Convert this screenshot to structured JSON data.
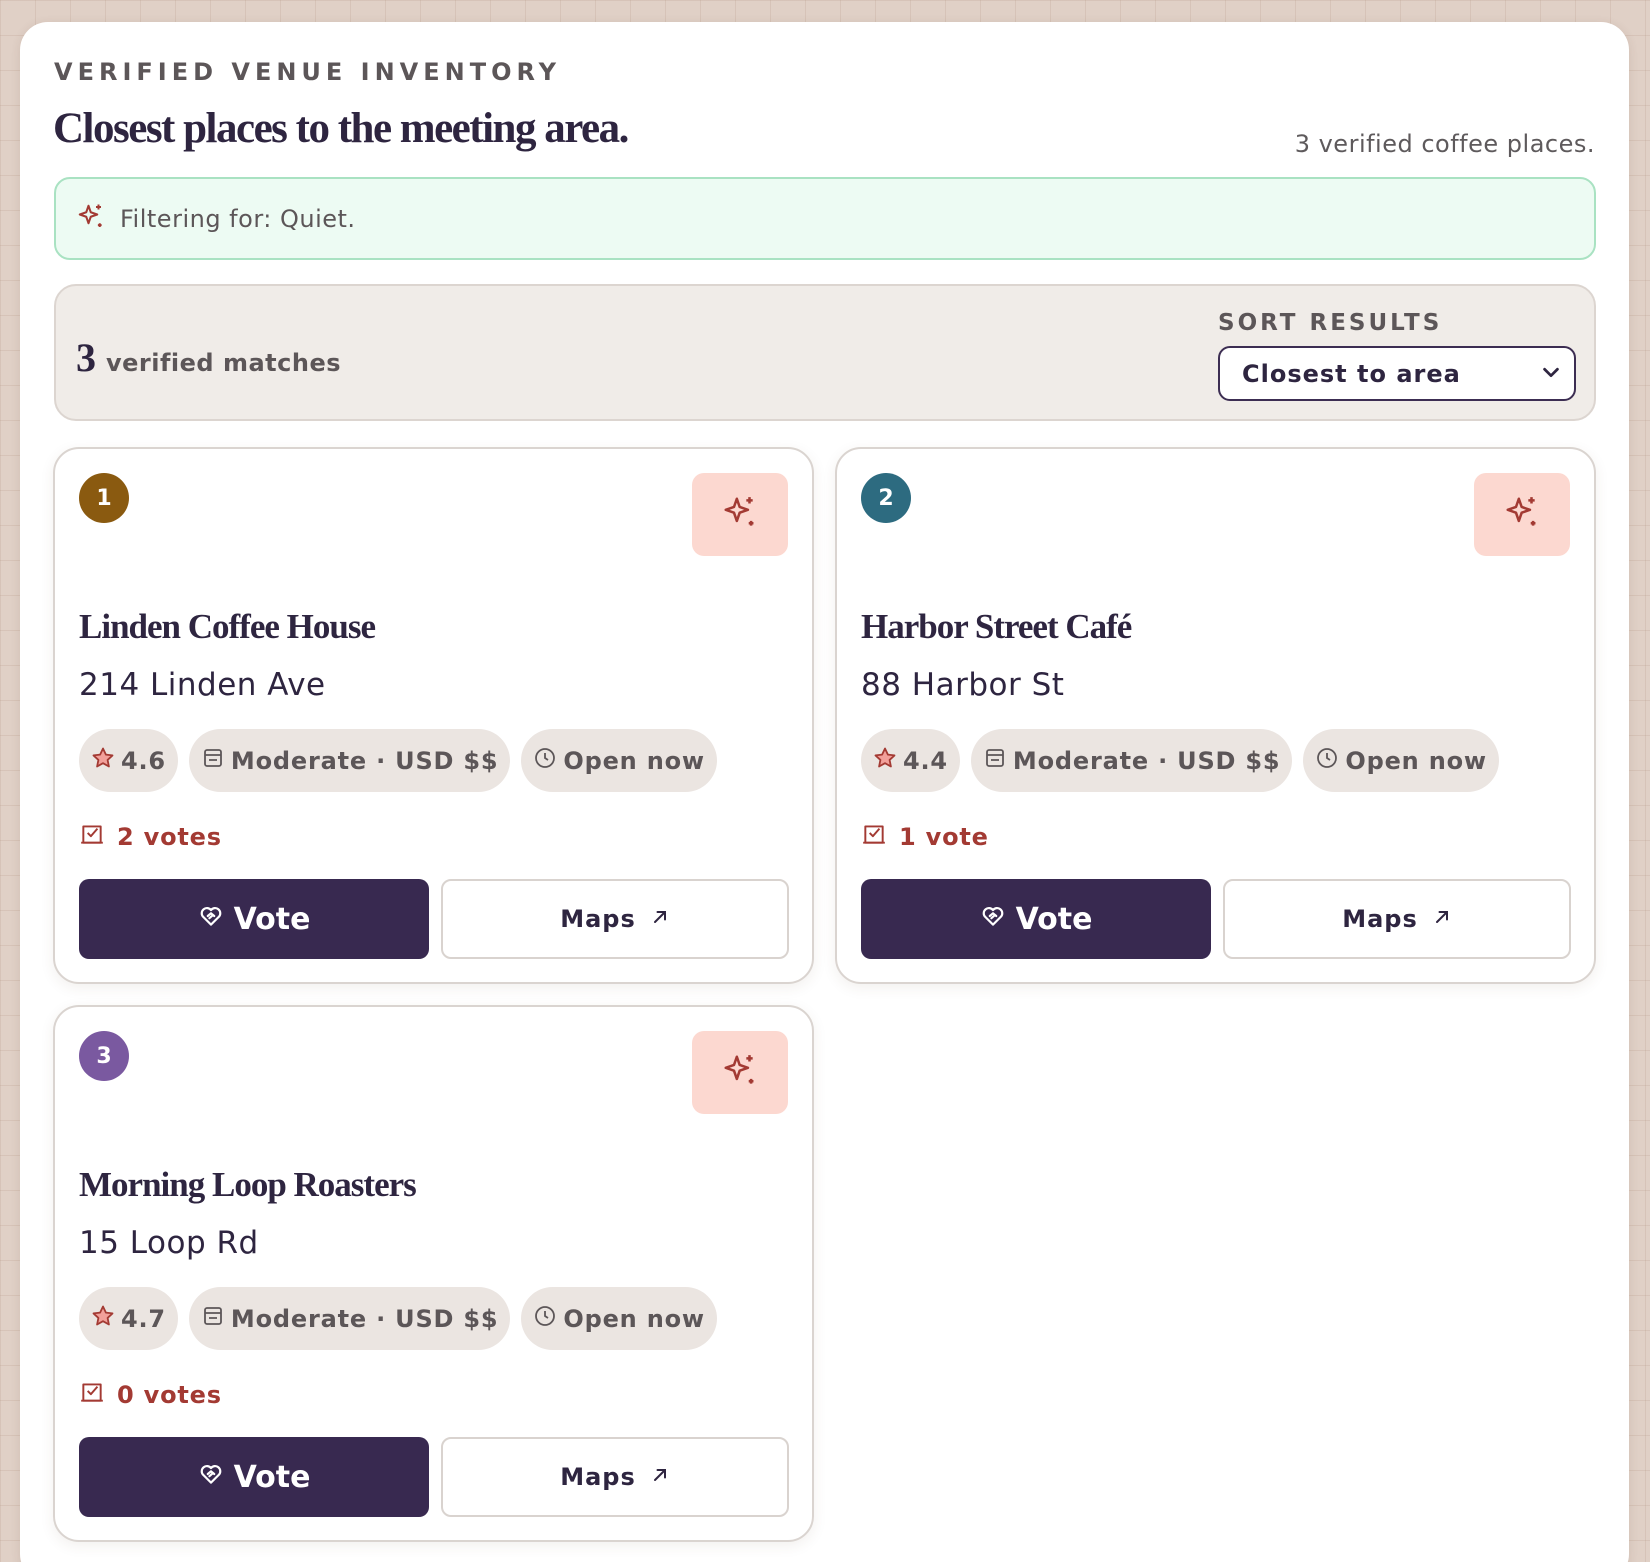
{
  "header": {
    "eyebrow": "VERIFIED VENUE INVENTORY",
    "title": "Closest places to the meeting area.",
    "place_count": "3 verified coffee places."
  },
  "filter": {
    "text": "Filtering for: Quiet.",
    "icon": "sparkle-icon"
  },
  "toolbar": {
    "match_count": "3",
    "match_label": "verified matches",
    "sort_label": "SORT RESULTS",
    "sort_value": "Closest to area"
  },
  "colors": {
    "ink": "#2e2540",
    "accent_red": "#a33a33",
    "button_dark": "#382950",
    "filter_bg": "#edfbf3",
    "sparkle_bg": "#fcd8d0"
  },
  "venues": [
    {
      "rank": "1",
      "rank_color": "#8a5a10",
      "name": "Linden Coffee House",
      "address": "214 Linden Ave",
      "rating": "4.6",
      "price": "Moderate · USD $$",
      "status": "Open now",
      "votes": "2 votes",
      "vote_label": "Vote",
      "maps_label": "Maps"
    },
    {
      "rank": "2",
      "rank_color": "#2d6b80",
      "name": "Harbor Street Café",
      "address": "88 Harbor St",
      "rating": "4.4",
      "price": "Moderate · USD $$",
      "status": "Open now",
      "votes": "1 vote",
      "vote_label": "Vote",
      "maps_label": "Maps"
    },
    {
      "rank": "3",
      "rank_color": "#7a59a0",
      "name": "Morning Loop Roasters",
      "address": "15 Loop Rd",
      "rating": "4.7",
      "price": "Moderate · USD $$",
      "status": "Open now",
      "votes": "0 votes",
      "vote_label": "Vote",
      "maps_label": "Maps"
    }
  ]
}
